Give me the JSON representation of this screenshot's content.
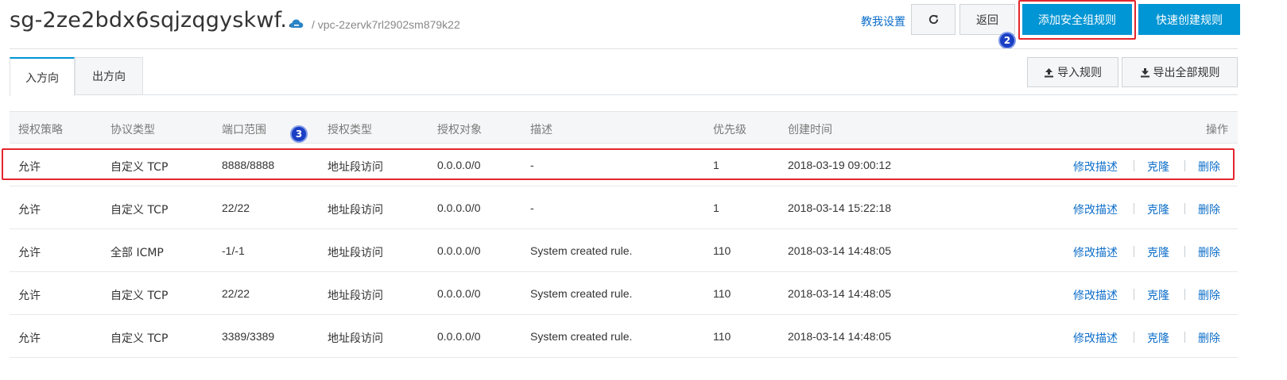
{
  "header": {
    "title": "sg-2ze2bdx6sqjzqgyskwf...",
    "vpc": "/ vpc-2zervk7rl2902sm879k22",
    "help_link": "教我设置",
    "back_label": "返回",
    "add_rule_label": "添加安全组规则",
    "quick_rule_label": "快速创建规则",
    "callout_add": "2"
  },
  "tabs": [
    {
      "label": "入方向",
      "active": true
    },
    {
      "label": "出方向",
      "active": false
    }
  ],
  "toolbar": {
    "import_label": "导入规则",
    "export_label": "导出全部规则"
  },
  "table": {
    "callout_row": "3",
    "columns": [
      "授权策略",
      "协议类型",
      "端口范围",
      "授权类型",
      "授权对象",
      "描述",
      "优先级",
      "创建时间",
      "操作"
    ],
    "actions": [
      "修改描述",
      "克隆",
      "删除"
    ],
    "rows": [
      {
        "policy": "允许",
        "protocol": "自定义 TCP",
        "port": "8888/8888",
        "auth_type": "地址段访问",
        "target": "0.0.0.0/0",
        "desc": "-",
        "priority": "1",
        "created": "2018-03-19 09:00:12"
      },
      {
        "policy": "允许",
        "protocol": "自定义 TCP",
        "port": "22/22",
        "auth_type": "地址段访问",
        "target": "0.0.0.0/0",
        "desc": "-",
        "priority": "1",
        "created": "2018-03-14 15:22:18"
      },
      {
        "policy": "允许",
        "protocol": "全部 ICMP",
        "port": "-1/-1",
        "auth_type": "地址段访问",
        "target": "0.0.0.0/0",
        "desc": "System created rule.",
        "priority": "110",
        "created": "2018-03-14 14:48:05"
      },
      {
        "policy": "允许",
        "protocol": "自定义 TCP",
        "port": "22/22",
        "auth_type": "地址段访问",
        "target": "0.0.0.0/0",
        "desc": "System created rule.",
        "priority": "110",
        "created": "2018-03-14 14:48:05"
      },
      {
        "policy": "允许",
        "protocol": "自定义 TCP",
        "port": "3389/3389",
        "auth_type": "地址段访问",
        "target": "0.0.0.0/0",
        "desc": "System created rule.",
        "priority": "110",
        "created": "2018-03-14 14:48:05"
      }
    ]
  },
  "colors": {
    "accent": "#0095d4",
    "link": "#0d6ec9",
    "highlight": "#e3262d",
    "callout": "#1a3fc4"
  },
  "icons": [
    "cloud-icon",
    "refresh-icon",
    "upload-icon",
    "download-icon"
  ]
}
